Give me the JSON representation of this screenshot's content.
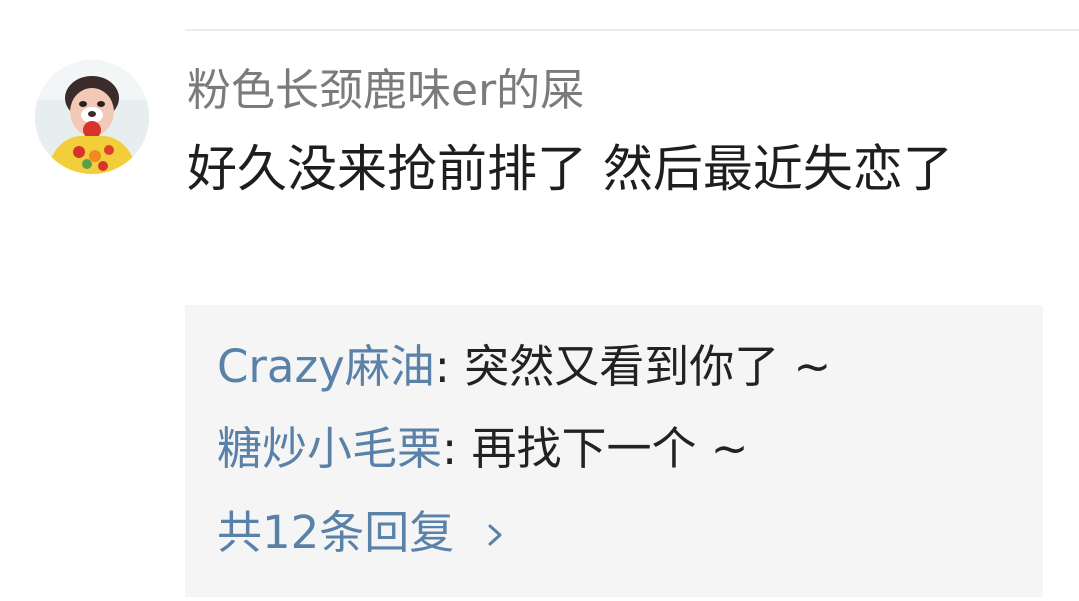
{
  "comment": {
    "username": "粉色长颈鹿味er的屎",
    "text": "好久没来抢前排了 然后最近失恋了"
  },
  "replies": [
    {
      "name": "Crazy麻油",
      "separator": ": ",
      "text": "突然又看到你了 ~"
    },
    {
      "name": "糖炒小毛栗",
      "separator": ": ",
      "text": "再找下一个 ~"
    }
  ],
  "more_replies_label": "共12条回复",
  "colors": {
    "link_blue": "#5a81a8",
    "username_gray": "#7b7b7b",
    "reply_bg": "#f5f5f5"
  },
  "icons": {
    "more_replies": "chevron-right-icon"
  }
}
